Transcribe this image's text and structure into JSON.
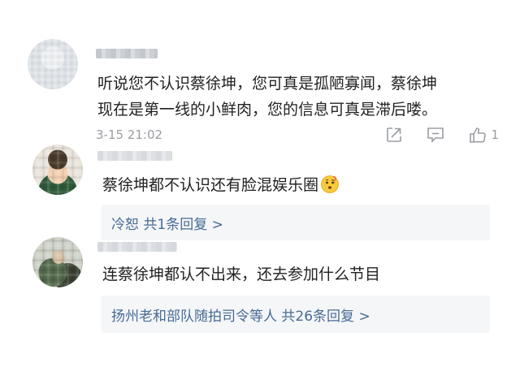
{
  "comments": [
    {
      "text_lines": [
        "听说您不认识蔡徐坤，您可真是孤陋寡闻，蔡徐坤",
        "现在是第一线的小鲜肉，您的信息可真是滞后喽。"
      ],
      "time": "3-15 21:02",
      "like_count": "1",
      "icons": [
        "share-icon",
        "comment-icon",
        "like-icon"
      ]
    },
    {
      "text": "蔡徐坤都不认识还有脸混娱乐圈",
      "emoji": "thinking-face-icon",
      "reply_summary": "冷恕  共1条回复 >"
    },
    {
      "text": "连蔡徐坤都认不出来，还去参加什么节目",
      "reply_summary": "扬州老和部队随拍司令等人  共26条回复 >"
    }
  ],
  "colors": {
    "link": "#476b95",
    "meta": "#9a9da3",
    "reply_bg": "#f5f6f8"
  }
}
